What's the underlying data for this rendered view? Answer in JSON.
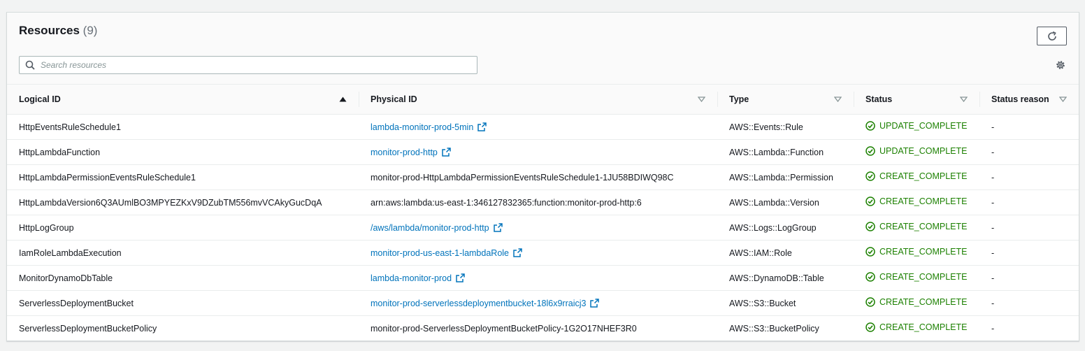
{
  "header": {
    "title": "Resources",
    "count": "(9)"
  },
  "search": {
    "placeholder": "Search resources",
    "value": ""
  },
  "table": {
    "columns": [
      {
        "label": "Logical ID",
        "sort": "ascending"
      },
      {
        "label": "Physical ID",
        "sort": "none"
      },
      {
        "label": "Type",
        "sort": "none"
      },
      {
        "label": "Status",
        "sort": "none"
      },
      {
        "label": "Status reason",
        "sort": "none"
      }
    ],
    "rows": [
      {
        "logical_id": "HttpEventsRuleSchedule1",
        "physical_id": "lambda-monitor-prod-5min",
        "physical_is_link": true,
        "type": "AWS::Events::Rule",
        "status": "UPDATE_COMPLETE",
        "reason": "-"
      },
      {
        "logical_id": "HttpLambdaFunction",
        "physical_id": "monitor-prod-http",
        "physical_is_link": true,
        "type": "AWS::Lambda::Function",
        "status": "UPDATE_COMPLETE",
        "reason": "-"
      },
      {
        "logical_id": "HttpLambdaPermissionEventsRuleSchedule1",
        "physical_id": "monitor-prod-HttpLambdaPermissionEventsRuleSchedule1-1JU58BDIWQ98C",
        "physical_is_link": false,
        "type": "AWS::Lambda::Permission",
        "status": "CREATE_COMPLETE",
        "reason": "-"
      },
      {
        "logical_id": "HttpLambdaVersion6Q3AUmlBO3MPYEZKxV9DZubTM556mvVCAkyGucDqA",
        "physical_id": "arn:aws:lambda:us-east-1:346127832365:function:monitor-prod-http:6",
        "physical_is_link": false,
        "type": "AWS::Lambda::Version",
        "status": "CREATE_COMPLETE",
        "reason": "-"
      },
      {
        "logical_id": "HttpLogGroup",
        "physical_id": "/aws/lambda/monitor-prod-http",
        "physical_is_link": true,
        "type": "AWS::Logs::LogGroup",
        "status": "CREATE_COMPLETE",
        "reason": "-"
      },
      {
        "logical_id": "IamRoleLambdaExecution",
        "physical_id": "monitor-prod-us-east-1-lambdaRole",
        "physical_is_link": true,
        "type": "AWS::IAM::Role",
        "status": "CREATE_COMPLETE",
        "reason": "-"
      },
      {
        "logical_id": "MonitorDynamoDbTable",
        "physical_id": "lambda-monitor-prod",
        "physical_is_link": true,
        "type": "AWS::DynamoDB::Table",
        "status": "CREATE_COMPLETE",
        "reason": "-"
      },
      {
        "logical_id": "ServerlessDeploymentBucket",
        "physical_id": "monitor-prod-serverlessdeploymentbucket-18l6x9rraicj3",
        "physical_is_link": true,
        "type": "AWS::S3::Bucket",
        "status": "CREATE_COMPLETE",
        "reason": "-"
      },
      {
        "logical_id": "ServerlessDeploymentBucketPolicy",
        "physical_id": "monitor-prod-ServerlessDeploymentBucketPolicy-1G2O17NHEF3R0",
        "physical_is_link": false,
        "type": "AWS::S3::BucketPolicy",
        "status": "CREATE_COMPLETE",
        "reason": "-"
      }
    ]
  },
  "icons": {
    "refresh": "refresh-icon",
    "search": "search-icon",
    "settings": "gear-icon",
    "sort_asc": "caret-up-icon",
    "sort_none": "caret-down-outline-icon",
    "external": "external-link-icon",
    "status_ok": "check-circle-icon"
  },
  "colors": {
    "link": "#0073bb",
    "success": "#1d8102",
    "text": "#16191f",
    "muted": "#687078"
  }
}
